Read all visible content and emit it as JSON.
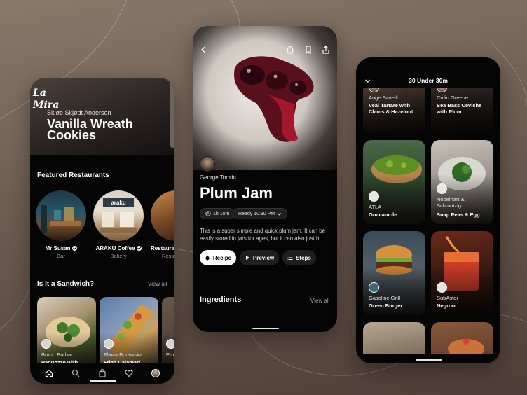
{
  "phone1": {
    "logo": "La Mira",
    "chef": "Skjøe Skjødt Andersen",
    "title": "Vanilla Wreath Cookies",
    "featured_title": "Featured Restaurants",
    "restaurants": [
      {
        "name": "Mr Susan",
        "type": "Bar"
      },
      {
        "name": "ARAKU Coffee",
        "type": "Bakery",
        "sign": "araku"
      },
      {
        "name": "Restaurant",
        "type": "Resta"
      }
    ],
    "sandwich_title": "Is It a Sandwich?",
    "view_all": "View all",
    "sandwiches": [
      {
        "chef": "Bruno Barbar",
        "dish": "Panuozzo with Mozzarella"
      },
      {
        "chef": "Flavia Borawska",
        "dish": "Fried Calamari"
      },
      {
        "chef": "Em",
        "dish": ""
      }
    ],
    "tabs": [
      "home-icon",
      "search-icon",
      "bag-icon",
      "heart-icon",
      "profile-icon"
    ]
  },
  "phone2": {
    "chef": "George Tomlin",
    "title": "Plum Jam",
    "time": "1h 10m",
    "ready": "Ready 10:30 PM",
    "description": "This is a super simple and quick plum jam. It can be easily stored in jars for ages, but it can also just b...",
    "buttons": {
      "recipe": "Recipe",
      "preview": "Preview",
      "steps": "Steps"
    },
    "ingredients": "Ingredients",
    "view_all": "View all"
  },
  "phone3": {
    "title": "30 Under 30m",
    "tiles": [
      {
        "chef": "Ange Savelli",
        "dish": "Veal Tartare with Clams & Hazelnut"
      },
      {
        "chef": "Cúán Greene",
        "dish": "Sea Bass Ceviche with Plum"
      },
      {
        "chef": "ATLA",
        "dish": "Guacamole"
      },
      {
        "chef": "Nobelhart & Schmutzig",
        "dish": "Snap Peas & Egg"
      },
      {
        "chef": "Gasoline Grill",
        "dish": "Green Burger"
      },
      {
        "chef": "SubAstor",
        "dish": "Negroni"
      },
      {
        "chef": "",
        "dish": ""
      },
      {
        "chef": "",
        "dish": ""
      }
    ]
  },
  "colors": {
    "background": "#6f5e52",
    "phone": "#050505",
    "accent_white": "#ffffff",
    "jam": "#5a0f1d"
  }
}
